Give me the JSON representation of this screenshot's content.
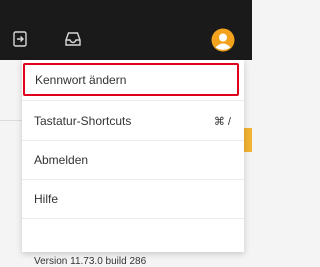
{
  "topbar": {
    "icons": [
      "logout-icon",
      "inbox-icon",
      "avatar"
    ],
    "avatar_color": "#f2a21d",
    "background": "#1a1a1a"
  },
  "menu": {
    "items": [
      {
        "label": "Kennwort ändern",
        "shortcut": ""
      },
      {
        "label": "Tastatur-Shortcuts",
        "shortcut": "⌘ /"
      },
      {
        "label": "Abmelden",
        "shortcut": ""
      },
      {
        "label": "Hilfe",
        "shortcut": ""
      }
    ],
    "version": "Version 11.73.0 build 286",
    "highlight_color": "#e0001b"
  }
}
